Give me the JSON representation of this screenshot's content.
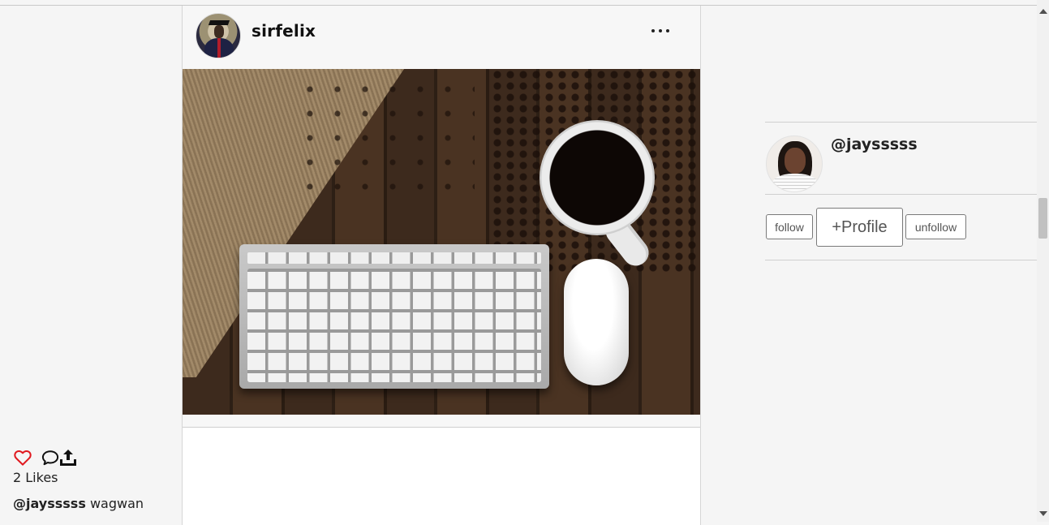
{
  "post": {
    "author": "sirfelix",
    "more_icon": "ellipsis-icon",
    "image_alt": "keyboard, mouse and coffee cup on wooden desk",
    "actions": {
      "like_icon": "heart-icon",
      "comment_icon": "comment-icon",
      "share_icon": "upload-share-icon",
      "like_color": "#e0191f"
    },
    "likes_text": "2 Likes",
    "caption": {
      "user": "@jaysssss",
      "text": "wagwan"
    }
  },
  "sidebar": {
    "handle": "@jaysssss",
    "follow_label": "follow",
    "profile_label": "+Profile",
    "unfollow_label": "unfollow"
  }
}
